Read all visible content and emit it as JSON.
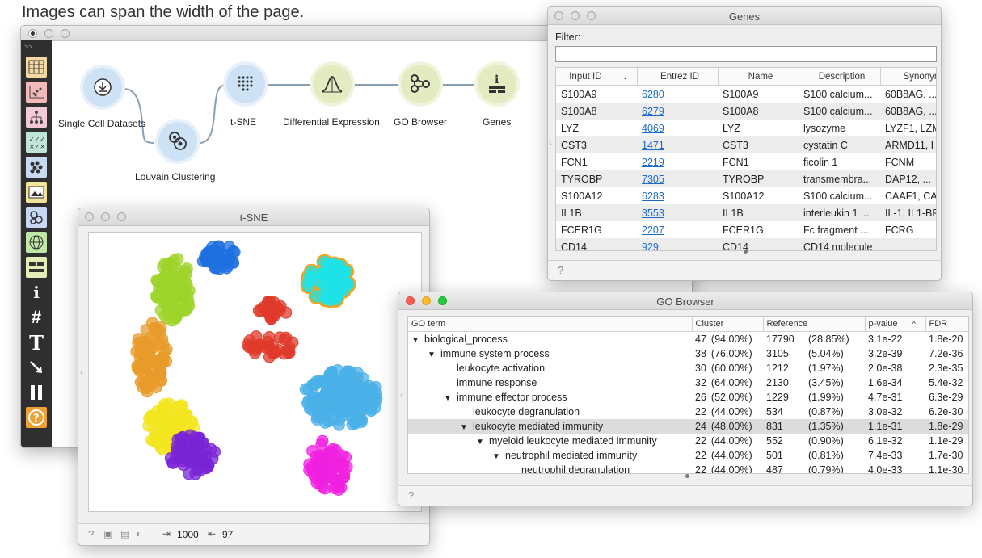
{
  "caption": "Images can span the width of the page.",
  "canvas": {
    "widgets": [
      {
        "name": "Single Cell Datasets",
        "icon": "download-icon"
      },
      {
        "name": "Louvain Clustering",
        "icon": "clustering-icon"
      },
      {
        "name": "t-SNE",
        "icon": "tsne-dots-icon"
      },
      {
        "name": "Differential Expression",
        "icon": "bell-curve-icon"
      },
      {
        "name": "GO Browser",
        "icon": "go-graph-icon"
      },
      {
        "name": "Genes",
        "icon": "info-table-icon"
      }
    ],
    "toolbar_icons": [
      "table-icon",
      "scatter-icon",
      "tree-icon",
      "checklist-icon",
      "dots-icon",
      "image-icon",
      "circles-icon",
      "globe-icon",
      "layout-icon",
      "info-icon",
      "hash-icon",
      "text-icon",
      "arrow-icon",
      "pause-icon",
      "help-icon"
    ]
  },
  "genes_window": {
    "title": "Genes",
    "filter_label": "Filter:",
    "filter_value": "",
    "columns": [
      "Input ID",
      "Entrez ID",
      "Name",
      "Description",
      "Synonym"
    ],
    "rows": [
      [
        "S100A9",
        "6280",
        "S100A9",
        "S100 calcium...",
        "60B8AG, ..."
      ],
      [
        "S100A8",
        "6279",
        "S100A8",
        "S100 calcium...",
        "60B8AG, ..."
      ],
      [
        "LYZ",
        "4069",
        "LYZ",
        "lysozyme",
        "LYZF1, LZM"
      ],
      [
        "CST3",
        "1471",
        "CST3",
        "cystatin C",
        "ARMD11, H"
      ],
      [
        "FCN1",
        "2219",
        "FCN1",
        "ficolin 1",
        "FCNM"
      ],
      [
        "TYROBP",
        "7305",
        "TYROBP",
        "transmembra...",
        "DAP12, ..."
      ],
      [
        "S100A12",
        "6283",
        "S100A12",
        "S100 calcium...",
        "CAAF1, CA"
      ],
      [
        "IL1B",
        "3553",
        "IL1B",
        "interleukin 1 ...",
        "IL-1, IL1-BF"
      ],
      [
        "FCER1G",
        "2207",
        "FCER1G",
        "Fc fragment ...",
        "FCRG"
      ],
      [
        "CD14",
        "929",
        "CD14",
        "CD14 molecule",
        ""
      ]
    ],
    "help": "?"
  },
  "tsne_window": {
    "title": "t-SNE",
    "input_count": "1000",
    "output_count": "97"
  },
  "go_window": {
    "title": "GO Browser",
    "columns": [
      "GO term",
      "Cluster",
      "Reference",
      "p-value",
      "FDR"
    ],
    "rows": [
      {
        "indent": 0,
        "arrow": "▼",
        "term": "biological_process",
        "cluster": "47",
        "cluster_pct": "(94.00%)",
        "ref": "17790",
        "ref_pct": "(28.85%)",
        "p": "3.1e-22",
        "fdr": "1.8e-20"
      },
      {
        "indent": 1,
        "arrow": "▼",
        "term": "immune system process",
        "cluster": "38",
        "cluster_pct": "(76.00%)",
        "ref": "3105",
        "ref_pct": "(5.04%)",
        "p": "3.2e-39",
        "fdr": "7.2e-36"
      },
      {
        "indent": 2,
        "arrow": "",
        "term": "leukocyte activation",
        "cluster": "30",
        "cluster_pct": "(60.00%)",
        "ref": "1212",
        "ref_pct": "(1.97%)",
        "p": "2.0e-38",
        "fdr": "2.3e-35"
      },
      {
        "indent": 2,
        "arrow": "",
        "term": "immune response",
        "cluster": "32",
        "cluster_pct": "(64.00%)",
        "ref": "2130",
        "ref_pct": "(3.45%)",
        "p": "1.6e-34",
        "fdr": "5.4e-32"
      },
      {
        "indent": 2,
        "arrow": "▼",
        "term": "immune effector process",
        "cluster": "26",
        "cluster_pct": "(52.00%)",
        "ref": "1229",
        "ref_pct": "(1.99%)",
        "p": "4.7e-31",
        "fdr": "6.3e-29"
      },
      {
        "indent": 3,
        "arrow": "",
        "term": "leukocyte degranulation",
        "cluster": "22",
        "cluster_pct": "(44.00%)",
        "ref": "534",
        "ref_pct": "(0.87%)",
        "p": "3.0e-32",
        "fdr": "6.2e-30"
      },
      {
        "indent": 3,
        "arrow": "▼",
        "term": "leukocyte mediated immunity",
        "cluster": "24",
        "cluster_pct": "(48.00%)",
        "ref": "831",
        "ref_pct": "(1.35%)",
        "p": "1.1e-31",
        "fdr": "1.8e-29",
        "selected": true
      },
      {
        "indent": 4,
        "arrow": "▼",
        "term": "myeloid leukocyte mediated immunity",
        "cluster": "22",
        "cluster_pct": "(44.00%)",
        "ref": "552",
        "ref_pct": "(0.90%)",
        "p": "6.1e-32",
        "fdr": "1.1e-29"
      },
      {
        "indent": 5,
        "arrow": "▼",
        "term": "neutrophil mediated immunity",
        "cluster": "22",
        "cluster_pct": "(44.00%)",
        "ref": "501",
        "ref_pct": "(0.81%)",
        "p": "7.4e-33",
        "fdr": "1.7e-30"
      },
      {
        "indent": 6,
        "arrow": "",
        "term": "neutrophil degranulation",
        "cluster": "22",
        "cluster_pct": "(44.00%)",
        "ref": "487",
        "ref_pct": "(0.79%)",
        "p": "4.0e-33",
        "fdr": "1.1e-30"
      }
    ],
    "sort_indicator": "^",
    "help": "?"
  },
  "colors": {
    "widget_blue": "#cde3f5",
    "widget_green": "#e3ecc0",
    "accent_link": "#1a6acb"
  }
}
